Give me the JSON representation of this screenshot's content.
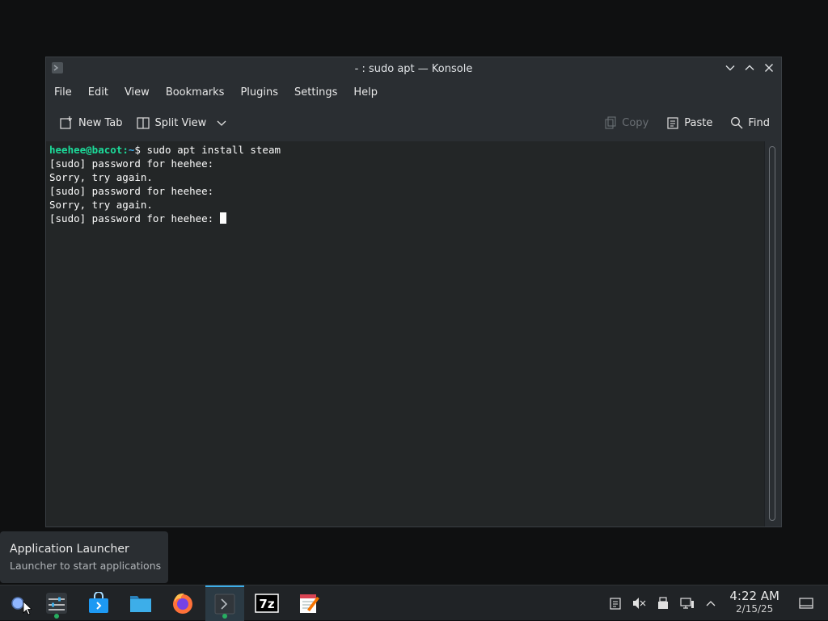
{
  "window": {
    "title": "- : sudo apt — Konsole",
    "menu": [
      "File",
      "Edit",
      "View",
      "Bookmarks",
      "Plugins",
      "Settings",
      "Help"
    ],
    "toolbar": {
      "new_tab": "New Tab",
      "split_view": "Split View",
      "copy": "Copy",
      "paste": "Paste",
      "find": "Find"
    }
  },
  "terminal": {
    "prompt_user": "heehee@bacot",
    "prompt_sep": ":",
    "prompt_path": "~",
    "prompt_symbol": "$ ",
    "command": "sudo apt install steam",
    "lines": [
      "[sudo] password for heehee:",
      "Sorry, try again.",
      "[sudo] password for heehee:",
      "Sorry, try again."
    ],
    "last_line": "[sudo] password for heehee: "
  },
  "tooltip": {
    "title": "Application Launcher",
    "subtitle": "Launcher to start applications"
  },
  "taskbar": {
    "apps": [
      "application-launcher-icon",
      "system-settings-icon",
      "discover-store-icon",
      "dolphin-files-icon",
      "firefox-icon",
      "konsole-icon",
      "7zip-icon",
      "text-editor-icon"
    ],
    "sevenzip_label": "7z",
    "clock_time": "4:22 AM",
    "clock_date": "2/15/25"
  },
  "colors": {
    "accent": "#3daee9",
    "prompt_user": "#1cdc9a",
    "terminal_bg": "#232627",
    "window_bg": "#2a2e32"
  }
}
